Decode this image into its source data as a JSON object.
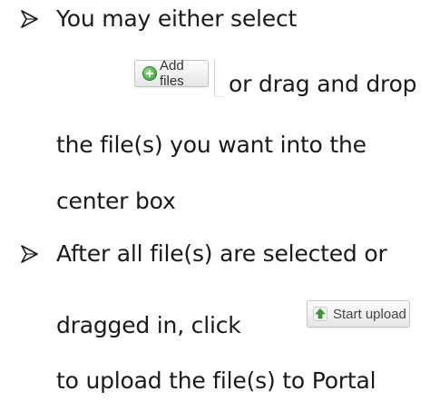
{
  "items": [
    {
      "line1": "You may either select",
      "button": {
        "label": "Add files",
        "icon": "plus-circle-icon"
      },
      "line2_suffix": "or drag and drop",
      "line3": "the file(s) you want into the",
      "line4": "center box"
    },
    {
      "line1": "After all file(s) are selected or",
      "line2_prefix": "dragged in, click",
      "button": {
        "label": "Start upload",
        "icon": "arrow-up-icon"
      },
      "line3": "to upload the file(s) to Portal"
    }
  ],
  "colors": {
    "text": "#1a1a1a",
    "add_icon": "#2f9a2a",
    "upload_icon": "#3a9a2a"
  }
}
